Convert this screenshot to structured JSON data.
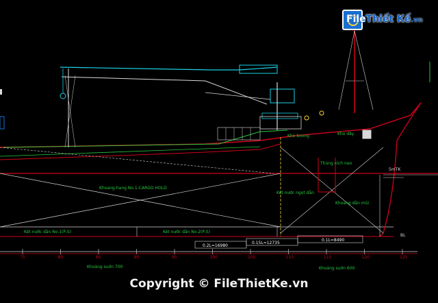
{
  "logo": {
    "prefix": "File",
    "brand": "Thiết Kế",
    "tld": ".vn"
  },
  "copyright": "Copyright © FileThietKe.vn",
  "labels": {
    "cargo_hold": "Khoang-hang No.1-CARGO HOLD",
    "kho_boong": "Kho boong",
    "kho_day": "Kho dây",
    "thung_xich": "Thùng xích neo",
    "ket_nuoc_dan": "Két nước ngọt dằn",
    "khoang_dan_mui": "Khoang dằn mũi",
    "ket_dan_1": "Két nước dằn No.1(P,S)",
    "ket_dan_2": "Két nước dằn No.2(P,S)",
    "khoang_xuan": "Khoảng suờn 700",
    "khoang_suon_600": "Khoảng suờn 600",
    "dim_1": "0.2L=16980",
    "dim_2": "0.15L=12735",
    "dim_3": "0.1L=8490",
    "marker_5m": "5mTK",
    "marker_bl": "BL"
  },
  "frame_ticks": [
    "75",
    "80",
    "85",
    "90",
    "95",
    "100",
    "105",
    "110",
    "115",
    "120",
    "125",
    "130",
    "135"
  ],
  "colors": {
    "hull": "#d0021b",
    "deck": "#27c93f",
    "crane": "#19d3e6",
    "text": "#27c93f",
    "dim": "#ffffff",
    "structure": "#d9d9d9",
    "highlight": "#ffd23f"
  }
}
